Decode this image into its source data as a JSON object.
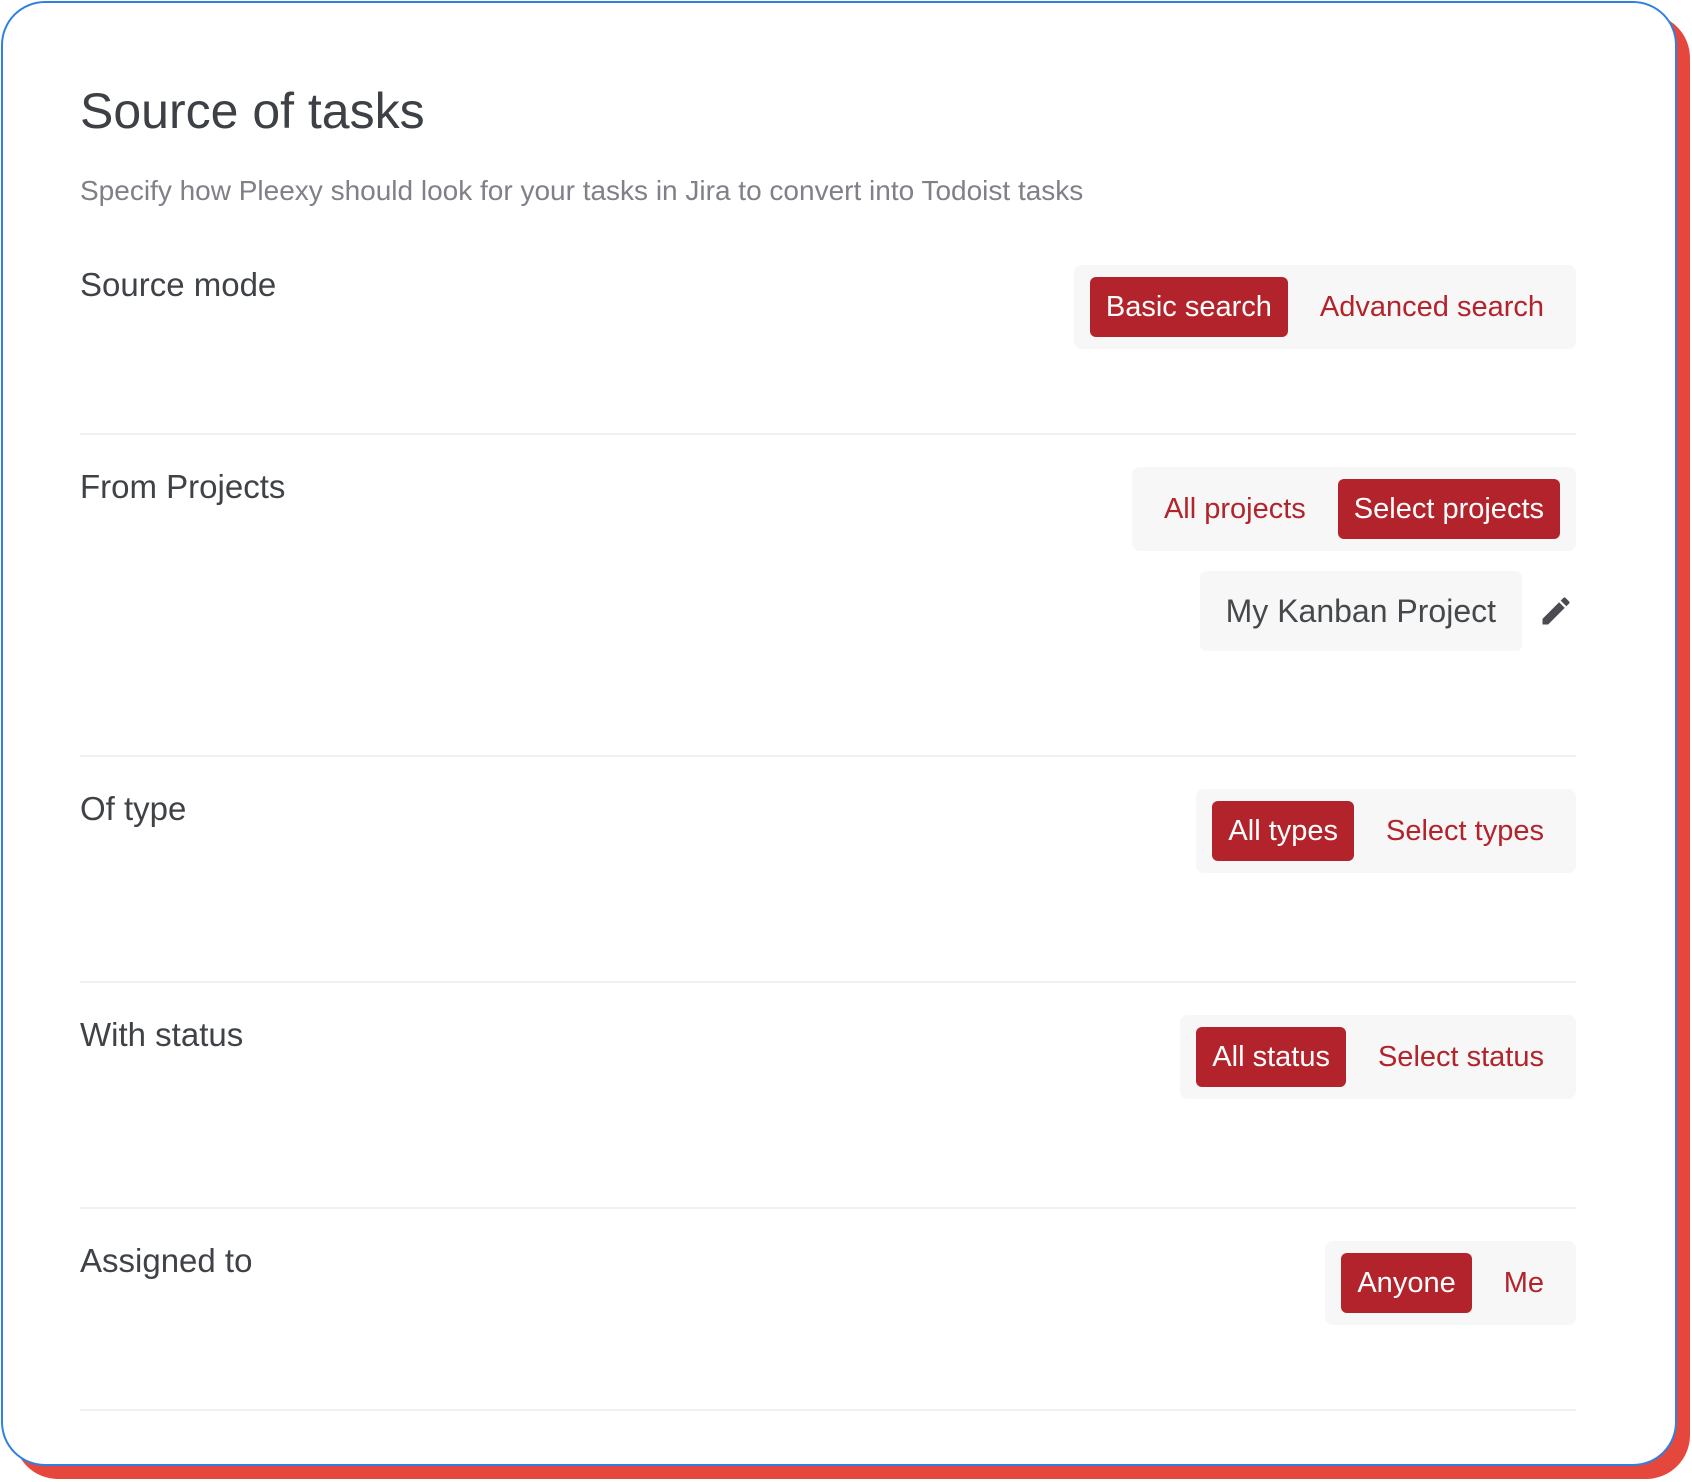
{
  "page": {
    "title": "Source of tasks",
    "subtitle": "Specify how Pleexy should look for your tasks in Jira to convert into Todoist tasks"
  },
  "colors": {
    "accent": "#b3232b",
    "card_border": "#2f80e0",
    "shadow": "#e5473c"
  },
  "sections": {
    "source_mode": {
      "label": "Source mode",
      "options": [
        "Basic search",
        "Advanced search"
      ],
      "selected": "Basic search"
    },
    "from_projects": {
      "label": "From Projects",
      "options": [
        "All projects",
        "Select projects"
      ],
      "selected": "Select projects",
      "selected_project": "My Kanban Project",
      "edit_icon": "pencil-icon"
    },
    "of_type": {
      "label": "Of type",
      "options": [
        "All types",
        "Select types"
      ],
      "selected": "All types"
    },
    "with_status": {
      "label": "With status",
      "options": [
        "All status",
        "Select status"
      ],
      "selected": "All status"
    },
    "assigned_to": {
      "label": "Assigned to",
      "options": [
        "Anyone",
        "Me"
      ],
      "selected": "Anyone"
    }
  }
}
